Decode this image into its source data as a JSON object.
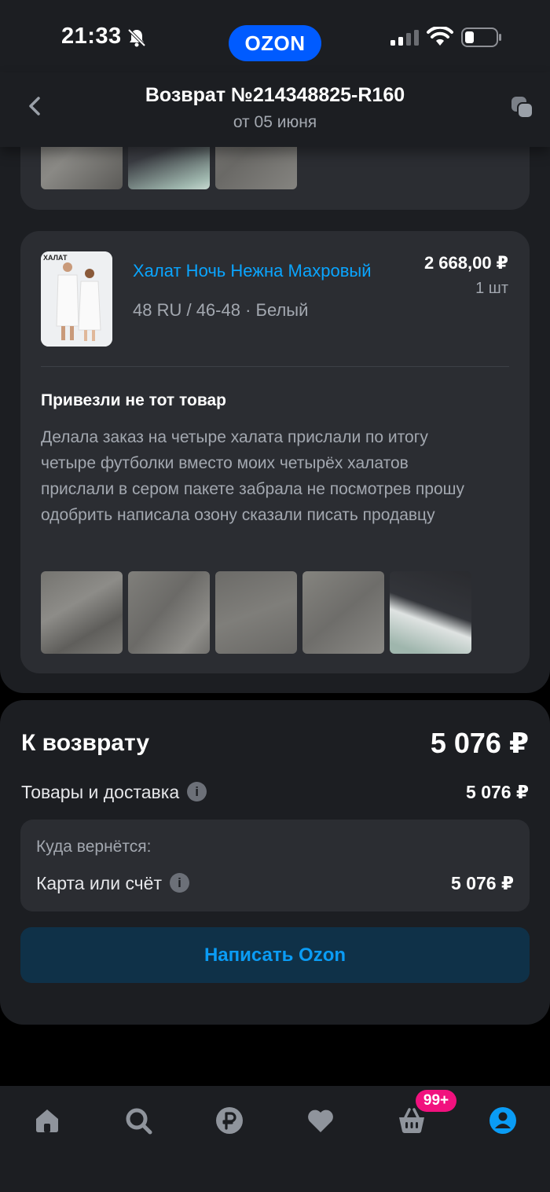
{
  "status_bar": {
    "time": "21:33",
    "logo_text": "OZON"
  },
  "header": {
    "title": "Возврат №214348825-R160",
    "subtitle": "от 05 июня"
  },
  "item": {
    "name": "Халат Ночь Нежна Махровый",
    "variant": "48 RU / 46-48 · Белый",
    "price": "2 668,00 ₽",
    "quantity": "1 шт",
    "image_caption": "ХАЛАТ",
    "reason_title": "Привезли не тот товар",
    "reason_text": "Делала заказ на четыре халата прислали по итогу четыре футболки вместо моих четырёх халатов прислали в сером пакете забрала не посмотрев прошу одобрить написала озону сказали писать продавцу"
  },
  "summary": {
    "title": "К возврату",
    "total": "5 076 ₽",
    "goods_label": "Товары и доставка",
    "goods_value": "5 076 ₽",
    "refund_where_label": "Куда вернётся:",
    "refund_method": "Карта или счёт",
    "refund_value": "5 076 ₽",
    "write_button": "Написать Ozon"
  },
  "tabbar": {
    "tabs": [
      "home-icon",
      "search-icon",
      "ruble-icon",
      "heart-icon",
      "cart-icon",
      "profile-icon"
    ],
    "cart_badge": "99+"
  },
  "colors": {
    "accent": "#0aa5ff",
    "badge": "#f1117e",
    "brand": "#005bff",
    "background": "#1c1e22",
    "card": "#2b2d32"
  }
}
